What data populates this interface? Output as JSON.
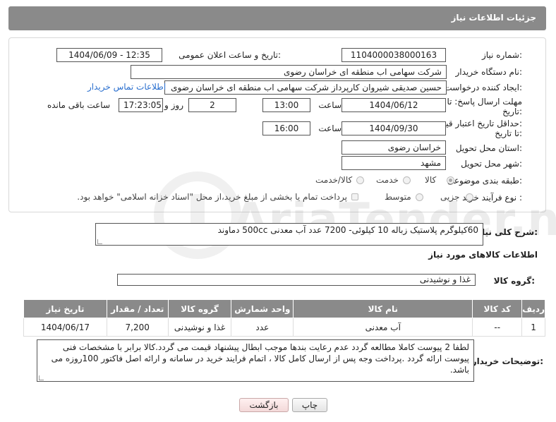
{
  "header": {
    "title": "جزئیات اطلاعات نیاز"
  },
  "form": {
    "need_number_label": "شماره نیاز:",
    "need_number": "1104000038000163",
    "announce_label": "تاریخ و ساعت اعلان عمومی:",
    "announce_value": "1404/06/09 - 12:35",
    "buyer_org_label": "نام دستگاه خریدار:",
    "buyer_org": "شرکت سهامی اب منطقه ای خراسان رضوی",
    "creator_label": "ایجاد کننده درخواست:",
    "creator": "حسین صدیقی شیروان کارپرداز شرکت سهامی اب منطقه ای خراسان رضوی",
    "contact_link": "اطلاعات تماس خریدار",
    "deadline_label_1": "مهلت ارسال پاسخ: تا",
    "deadline_label_2": "تاریخ:",
    "deadline_date": "1404/06/12",
    "time_label": "ساعت",
    "deadline_time": "13:00",
    "days_value": "2",
    "days_label": "روز و",
    "remaining_time": "17:23:05",
    "remaining_label": "ساعت باقی مانده",
    "validity_label_1": "حداقل تاریخ اعتبار قیمت:",
    "validity_label_2": "تا تاریخ:",
    "validity_date": "1404/09/30",
    "validity_time_label": "ساعت",
    "validity_time": "16:00",
    "province_label": "استان محل تحویل:",
    "province": "خراسان رضوی",
    "city_label": "شهر محل تحویل:",
    "city": "مشهد",
    "category_label": "طبقه بندی موضوعی:",
    "category_options": [
      "کالا",
      "خدمت",
      "کالا/خدمت"
    ],
    "purchase_type_label": "نوع فرآیند خرید :",
    "purchase_options": [
      "جزیی",
      "متوسط"
    ],
    "payment_note": "پرداخت تمام یا بخشی از مبلغ خرید،از محل \"اسناد خزانه اسلامی\" خواهد بود."
  },
  "summary": {
    "label": "شرح کلی نیاز:",
    "text": "60کیلوگرم پلاستیک زباله 10 کیلوئی- 7200 عدد آب معدنی 500cc دماوند"
  },
  "goods_section": {
    "title": "اطلاعات کالاهای مورد نیاز",
    "group_label": "گروه کالا:",
    "group_value": "غذا و نوشیدنی"
  },
  "table": {
    "headers": [
      "ردیف",
      "کد کالا",
      "نام کالا",
      "واحد شمارش",
      "گروه کالا",
      "تعداد / مقدار",
      "تاریخ نیاز"
    ],
    "rows": [
      [
        "1",
        "--",
        "آب معدنی",
        "عدد",
        "غذا و نوشیدنی",
        "7,200",
        "1404/06/17"
      ]
    ]
  },
  "buyer_notes": {
    "label": "توضیحات خریدار:",
    "text": "لطفا 2 پیوست کاملا مطالعه گردد عدم رعایت بندها موجب ابطال پیشنهاد قیمت می گردد.کالا برابر با مشخصات فنی پیوست ارائه گردد .پرداخت وجه پس از ارسال کامل کالا ، اتمام فرایند خرید در سامانه و ارائه اصل فاکتور 100روزه می باشد."
  },
  "buttons": {
    "print": "چاپ",
    "back": "بازگشت"
  },
  "watermark": {
    "text": "AriaTender.neT"
  },
  "colors": {
    "header_bg": "#8a8a8a",
    "link": "#2a6fcf"
  }
}
